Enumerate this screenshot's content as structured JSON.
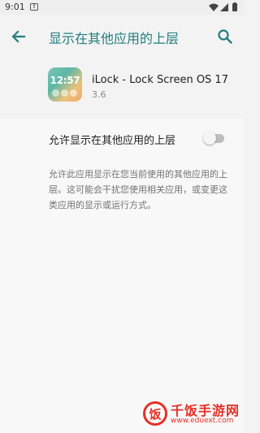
{
  "status_bar": {
    "time": "9:01",
    "notification_icon": "android-notification-icon",
    "icons": [
      "wifi-icon",
      "signal-icon",
      "battery-icon"
    ]
  },
  "app_bar": {
    "title": "显示在其他应用的上层",
    "back_icon": "arrow-back-icon",
    "search_icon": "search-icon",
    "accent": "#1f7f7e"
  },
  "app": {
    "name": "iLock - Lock Screen OS 17",
    "version": "3.6",
    "icon_clock": "12:57"
  },
  "setting": {
    "label": "允许显示在其他应用的上层",
    "enabled": false,
    "description": "允许此应用显示在您当前使用的其他应用的上层。这可能会干扰您使用相关应用，或变更这类应用的显示或运行方式。"
  },
  "watermark": {
    "logo_char": "饭",
    "title": "千饭手游网",
    "url": "www.eduext.com",
    "color": "#e63027"
  }
}
